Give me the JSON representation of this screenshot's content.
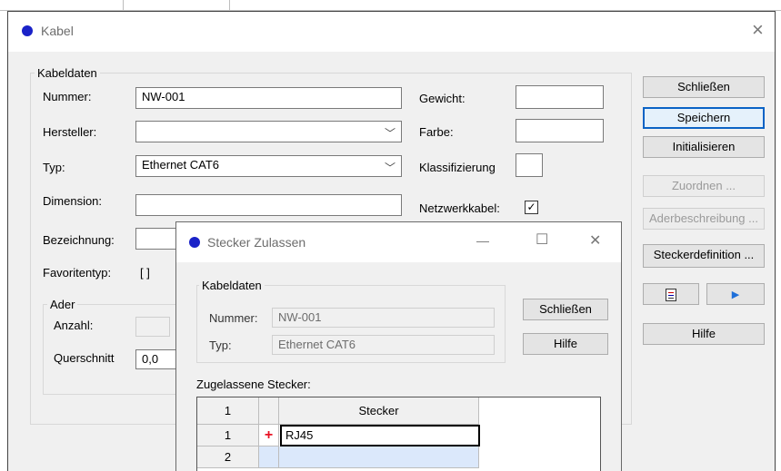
{
  "main_window": {
    "title": "Kabel",
    "close_glyph": "×",
    "group_title": "Kabeldaten",
    "nummer_label": "Nummer:",
    "nummer_value": "NW-001",
    "hersteller_label": "Hersteller:",
    "hersteller_value": "",
    "typ_label": "Typ:",
    "typ_value": "Ethernet CAT6",
    "dimension_label": "Dimension:",
    "dimension_value": "",
    "bezeichnung_label": "Bezeichnung:",
    "favoritentyp_label": "Favoritentyp:",
    "favoritentyp_value": "[ ]",
    "ader_group_title": "Ader",
    "anzahl_label": "Anzahl:",
    "querschnitt_label": "Querschnitt",
    "querschnitt_value": "0,0",
    "gewicht_label": "Gewicht:",
    "farbe_label": "Farbe:",
    "klassifizierung_label": "Klassifizierung",
    "netzwerkkabel_label": "Netzwerkkabel:",
    "netzwerkkabel_checked": true,
    "buttons": {
      "schliessen": "Schließen",
      "speichern": "Speichern",
      "initialisieren": "Initialisieren",
      "zuordnen": "Zuordnen ...",
      "aderbeschreibung": "Aderbeschreibung ...",
      "steckerdefinition": "Steckerdefinition ...",
      "hilfe": "Hilfe"
    },
    "icons": [
      "document-icon",
      "play-arrow-icon"
    ]
  },
  "dialog": {
    "title": "Stecker Zulassen",
    "minimize_glyph": "—",
    "maximize_glyph": "☐",
    "close_glyph": "✕",
    "group_title": "Kabeldaten",
    "nummer_label": "Nummer:",
    "nummer_value": "NW-001",
    "typ_label": "Typ:",
    "typ_value": "Ethernet CAT6",
    "schliessen_button": "Schließen",
    "hilfe_button": "Hilfe",
    "grid_title": "Zugelassene Stecker:",
    "grid": {
      "corner_header": "1",
      "column_header": "Stecker",
      "rows": [
        {
          "index": "1",
          "marker": "+",
          "value": "RJ45"
        },
        {
          "index": "2",
          "marker": "",
          "value": ""
        }
      ]
    }
  },
  "colors": {
    "dot": "#1a22c8",
    "focus_border": "#0b63c5",
    "marker_red": "#e81123",
    "row_blue": "#dbe8fb"
  }
}
